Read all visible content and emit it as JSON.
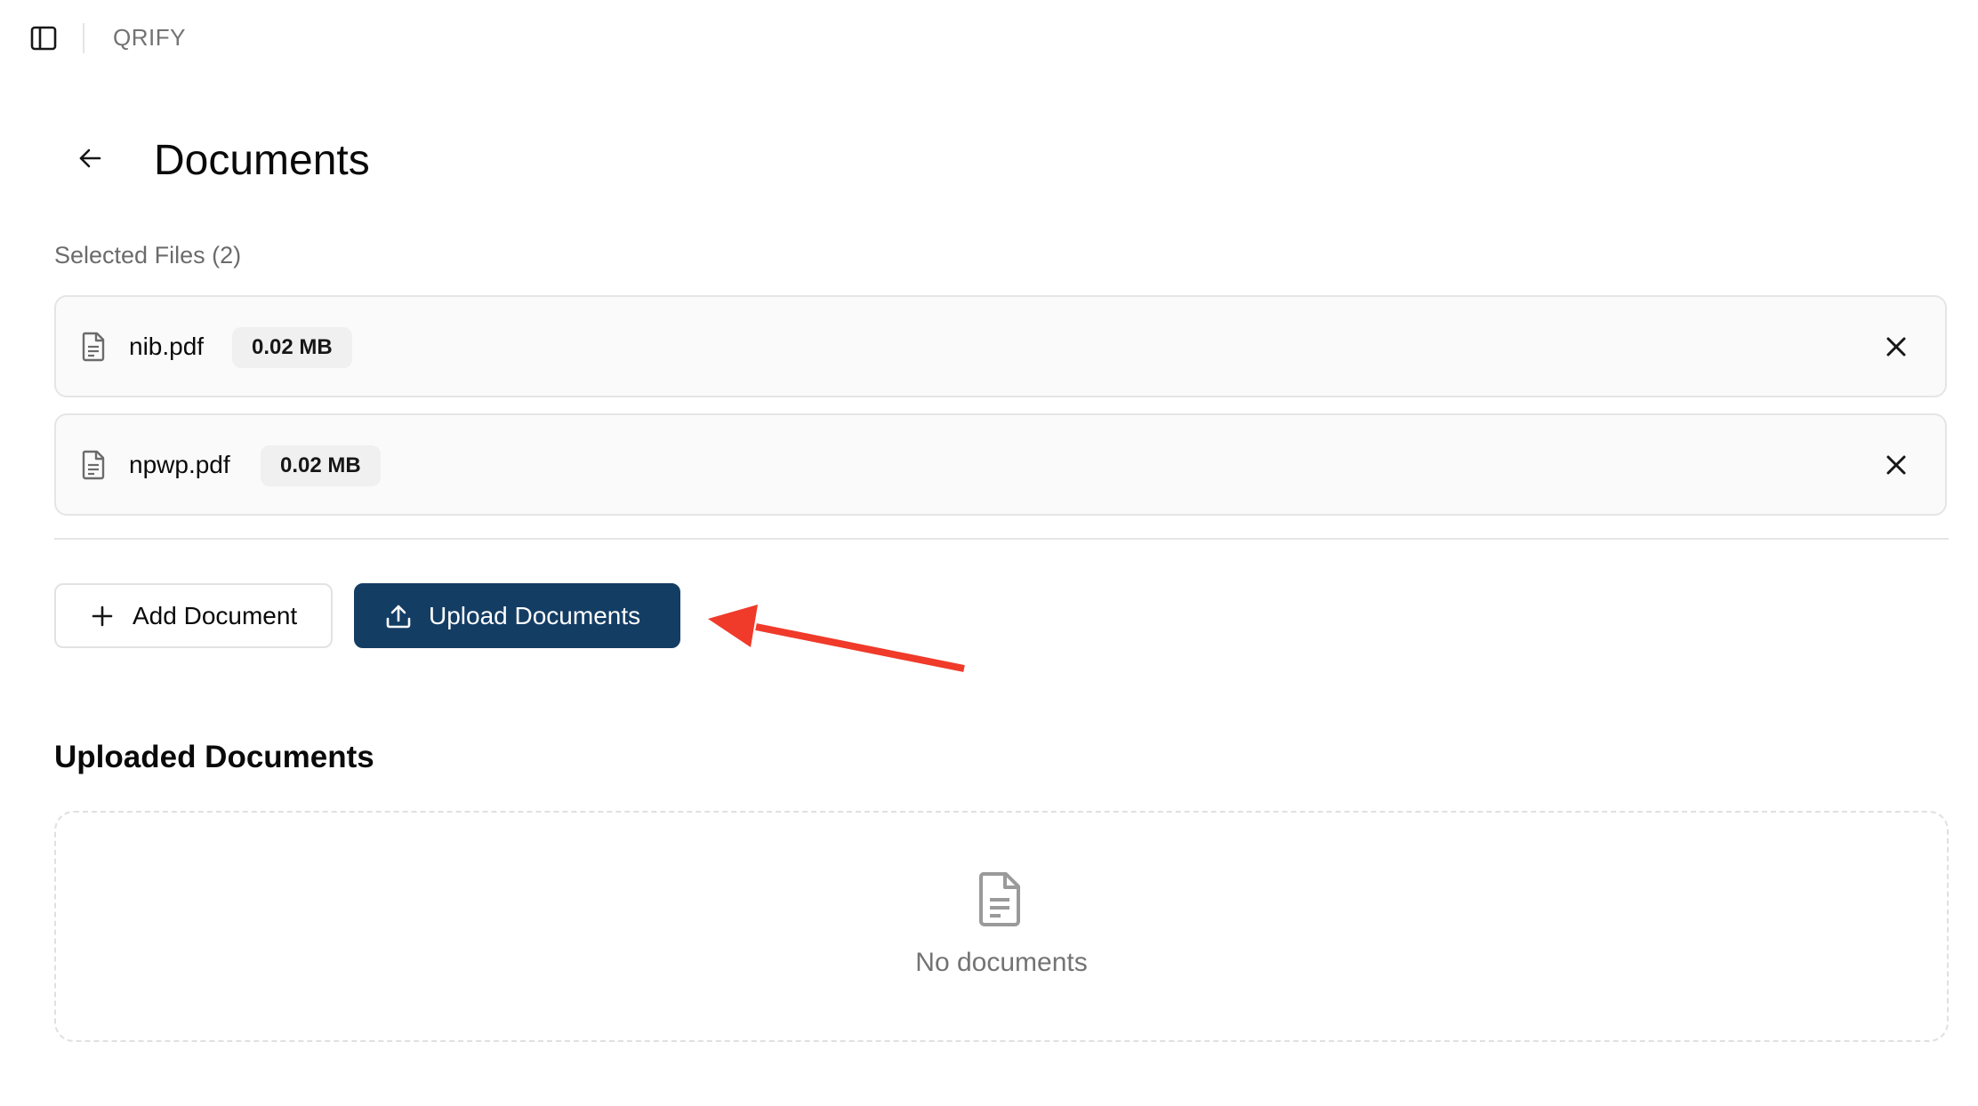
{
  "topbar": {
    "app_name": "QRIFY",
    "toggle_icon": "sidebar-toggle-icon"
  },
  "header": {
    "title": "Documents",
    "back_icon": "arrow-left-icon"
  },
  "selected_files": {
    "label": "Selected Files (2)",
    "items": [
      {
        "name": "nib.pdf",
        "size": "0.02 MB"
      },
      {
        "name": "npwp.pdf",
        "size": "0.02 MB"
      }
    ]
  },
  "actions": {
    "add_label": "Add Document",
    "upload_label": "Upload Documents",
    "primary_color": "#143d64"
  },
  "annotation": {
    "arrow_color": "#f03a2a"
  },
  "uploaded": {
    "heading": "Uploaded Documents",
    "empty_text": "No documents"
  }
}
